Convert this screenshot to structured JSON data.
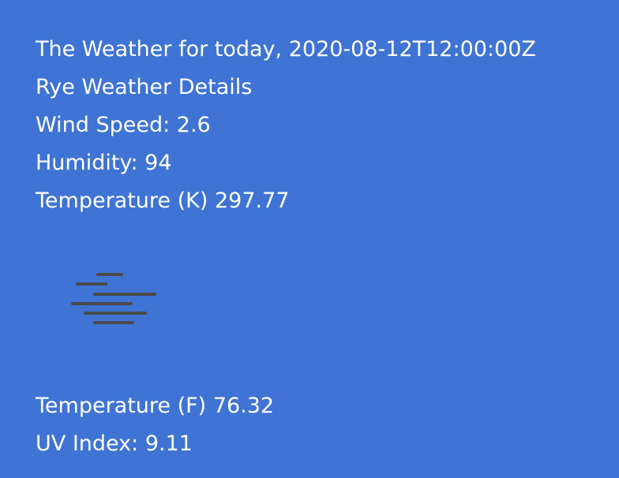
{
  "weather": {
    "title_prefix": "The Weather for today,",
    "date": "2020-08-12T12:00:00Z",
    "location_heading": "Rye Weather Details",
    "wind_speed_label": "Wind Speed:",
    "wind_speed": "2.6",
    "humidity_label": "Humidity:",
    "humidity": "94",
    "temp_k_label": "Temperature (K)",
    "temp_k": "297.77",
    "condition_icon": "fog-icon",
    "temp_f_label": "Temperature (F)",
    "temp_f": "76.32",
    "uv_label": "UV Index:",
    "uv_index": "9.11"
  },
  "colors": {
    "background": "#3f74d4",
    "text": "#ffffff",
    "icon": "#4a4a4a"
  }
}
